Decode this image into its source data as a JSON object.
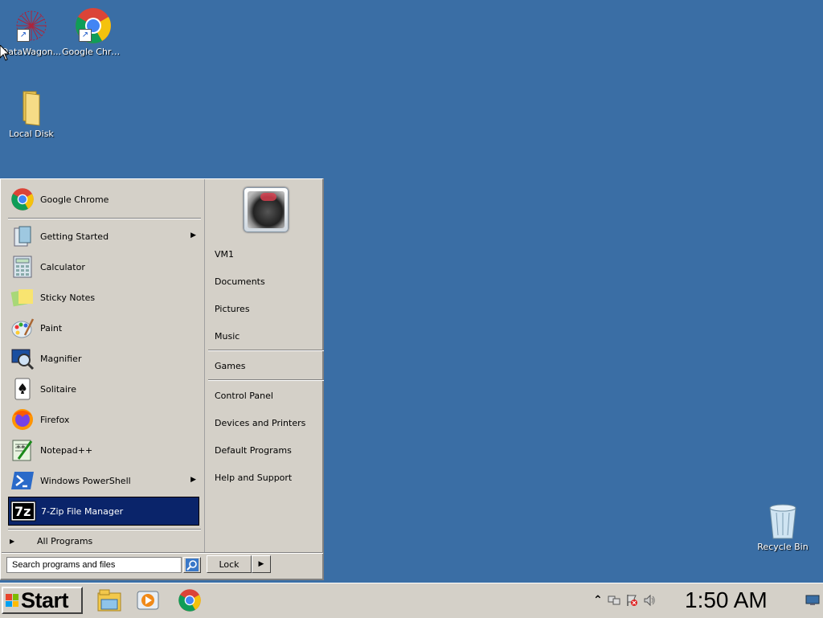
{
  "desktop": {
    "icons": [
      {
        "label": "DataWagon...",
        "icon": "datawagon-icon"
      },
      {
        "label": "Google Chrome",
        "icon": "chrome-icon"
      },
      {
        "label": "Local Disk",
        "icon": "folder-icon"
      },
      {
        "label": "Recycle Bin",
        "icon": "recycle-bin-icon"
      }
    ]
  },
  "start_menu": {
    "pinned": {
      "label": "Google Chrome",
      "icon": "chrome-icon"
    },
    "programs": [
      {
        "label": "Getting Started",
        "icon": "getting-started-icon",
        "has_submenu": true
      },
      {
        "label": "Calculator",
        "icon": "calculator-icon"
      },
      {
        "label": "Sticky Notes",
        "icon": "sticky-notes-icon"
      },
      {
        "label": "Paint",
        "icon": "paint-icon"
      },
      {
        "label": "Magnifier",
        "icon": "magnifier-icon"
      },
      {
        "label": "Solitaire",
        "icon": "solitaire-icon"
      },
      {
        "label": "Firefox",
        "icon": "firefox-icon"
      },
      {
        "label": "Notepad++",
        "icon": "notepadpp-icon"
      },
      {
        "label": "Windows PowerShell",
        "icon": "powershell-icon",
        "has_submenu": true
      },
      {
        "label": "7-Zip File Manager",
        "icon": "7zip-icon",
        "selected": true
      }
    ],
    "all_programs": "All Programs",
    "search_placeholder": "Search programs and files",
    "right": {
      "user": "VM1",
      "links_group1": [
        "Documents",
        "Pictures",
        "Music"
      ],
      "links_group2": [
        "Games"
      ],
      "links_group3": [
        "Control Panel",
        "Devices and Printers",
        "Default Programs",
        "Help and Support"
      ]
    },
    "lock_label": "Lock"
  },
  "taskbar": {
    "start_label": "Start",
    "pinned": [
      "explorer-icon",
      "media-player-icon",
      "chrome-icon"
    ],
    "clock": "1:50 AM"
  }
}
